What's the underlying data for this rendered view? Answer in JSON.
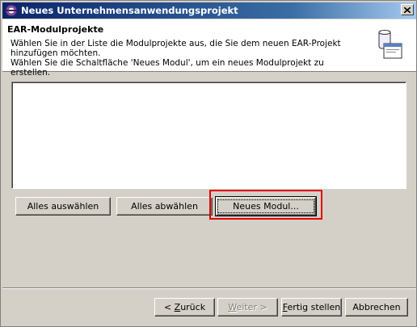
{
  "window": {
    "title": "Neues Unternehmensanwendungsprojekt",
    "title_gradient": [
      "#0a246a",
      "#a6caf0"
    ]
  },
  "header": {
    "title": "EAR-Modulprojekte",
    "description_line1": "Wählen Sie in der Liste die Modulprojekte aus, die Sie dem neuen EAR-Projekt hinzufügen möchten.",
    "description_line2": "Wählen Sie die Schaltfläche 'Neues Modul', um ein neues Modulprojekt zu erstellen."
  },
  "module_list": {
    "items": []
  },
  "buttons": {
    "select_all": "Alles auswählen",
    "deselect_all": "Alles abwählen",
    "new_module": "Neues Modul...",
    "back_prefix": "< ",
    "back_mnemonic": "Z",
    "back_rest": "urück",
    "next_mnemonic": "W",
    "next_rest": "eiter >",
    "finish_mnemonic": "F",
    "finish_rest": "ertig stellen",
    "cancel": "Abbrechen"
  },
  "annotation": {
    "highlight_color": "#e60000",
    "target": "Neues Modul..."
  }
}
